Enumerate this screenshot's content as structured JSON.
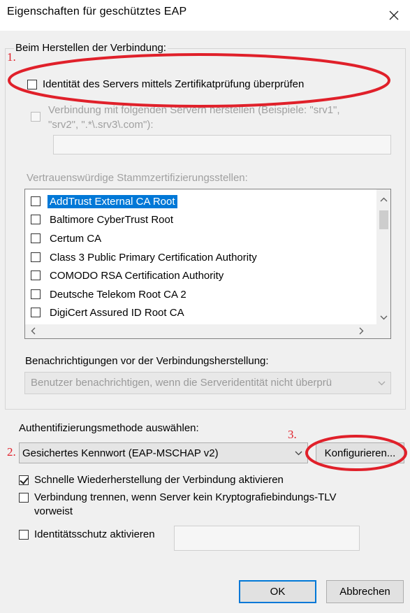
{
  "window": {
    "title": "Eigenschaften für geschütztes EAP"
  },
  "group": {
    "label": "Beim Herstellen der Verbindung:"
  },
  "verify_cert": {
    "label": "Identität des Servers mittels Zertifikatprüfung überprüfen",
    "checked": false
  },
  "connect_servers": {
    "label_line1": "Verbindung mit folgenden Servern herstellen (Beispiele: \"srv1\",",
    "label_line2": "\"srv2\", \".*\\.srv3\\.com\"):",
    "value": ""
  },
  "trusted_roots": {
    "label": "Vertrauenswürdige Stammzertifizierungsstellen:",
    "items": [
      {
        "label": "AddTrust External CA Root",
        "selected": true
      },
      {
        "label": "Baltimore CyberTrust Root"
      },
      {
        "label": "Certum CA"
      },
      {
        "label": "Class 3 Public Primary Certification Authority"
      },
      {
        "label": "COMODO RSA Certification Authority"
      },
      {
        "label": "Deutsche Telekom Root CA 2"
      },
      {
        "label": "DigiCert Assured ID Root CA"
      }
    ]
  },
  "notifications": {
    "label": "Benachrichtigungen vor der Verbindungsherstellung:",
    "value": "Benutzer benachrichtigen, wenn die Serveridentität nicht überprü"
  },
  "auth": {
    "label": "Authentifizierungsmethode auswählen:",
    "value": "Gesichertes Kennwort (EAP-MSCHAP v2)",
    "configure_label": "Konfigurieren..."
  },
  "fast_reconnect": {
    "label": "Schnelle Wiederherstellung der Verbindung aktivieren",
    "checked": true
  },
  "disconnect_tlv": {
    "label_line1": "Verbindung trennen, wenn Server kein Kryptografiebindungs-TLV",
    "label_line2": "vorweist",
    "checked": false
  },
  "identity_privacy": {
    "label": "Identitätsschutz aktivieren",
    "checked": false,
    "value": ""
  },
  "buttons": {
    "ok": "OK",
    "cancel": "Abbrechen"
  },
  "annotations": {
    "one": "1.",
    "two": "2.",
    "three": "3.",
    "color": "#e0202a"
  },
  "colors": {
    "selection": "#0078d7",
    "dialog_bg": "#f0f0f0"
  }
}
